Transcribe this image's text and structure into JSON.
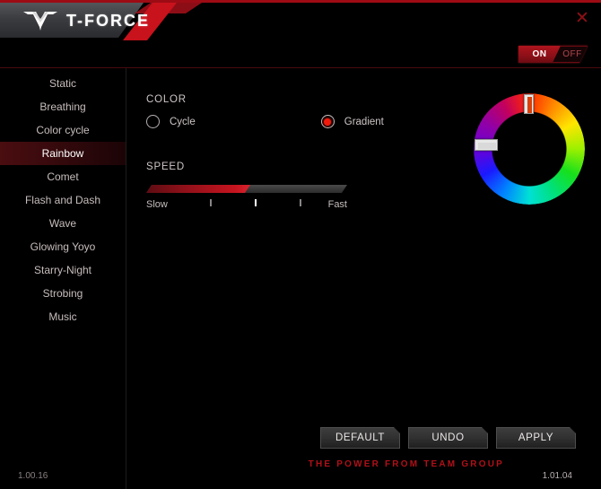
{
  "window": {
    "brand": "T-FORCE",
    "logo_icon": "tforce-logo-icon",
    "close_icon": "close-icon"
  },
  "power_toggle": {
    "on_label": "ON",
    "off_label": "OFF",
    "state": "ON"
  },
  "sidebar": {
    "items": [
      {
        "label": "Static",
        "active": false
      },
      {
        "label": "Breathing",
        "active": false
      },
      {
        "label": "Color cycle",
        "active": false
      },
      {
        "label": "Rainbow",
        "active": true
      },
      {
        "label": "Comet",
        "active": false
      },
      {
        "label": "Flash and Dash",
        "active": false
      },
      {
        "label": "Wave",
        "active": false
      },
      {
        "label": "Glowing Yoyo",
        "active": false
      },
      {
        "label": "Starry-Night",
        "active": false
      },
      {
        "label": "Strobing",
        "active": false
      },
      {
        "label": "Music",
        "active": false
      }
    ],
    "firmware_version": "1.00.16"
  },
  "color_section": {
    "title": "COLOR",
    "options": [
      {
        "label": "Cycle",
        "selected": false
      },
      {
        "label": "Gradient",
        "selected": true
      }
    ]
  },
  "speed_section": {
    "title": "SPEED",
    "min_label": "Slow",
    "max_label": "Fast",
    "value_percent": 50
  },
  "color_wheel": {
    "name": "color-wheel",
    "handles": [
      {
        "name": "wheel-handle-top",
        "position": "top"
      },
      {
        "name": "wheel-handle-left",
        "position": "left"
      }
    ]
  },
  "footer": {
    "buttons": [
      {
        "label": "DEFAULT",
        "name": "default-button"
      },
      {
        "label": "UNDO",
        "name": "undo-button"
      },
      {
        "label": "APPLY",
        "name": "apply-button"
      }
    ],
    "tagline": "THE POWER FROM TEAM GROUP",
    "app_version": "1.01.04"
  },
  "colors": {
    "accent_red": "#9d0b14",
    "bright_red": "#c8121c",
    "radio_red": "#f21a0c",
    "text": "#cfc6c6"
  }
}
